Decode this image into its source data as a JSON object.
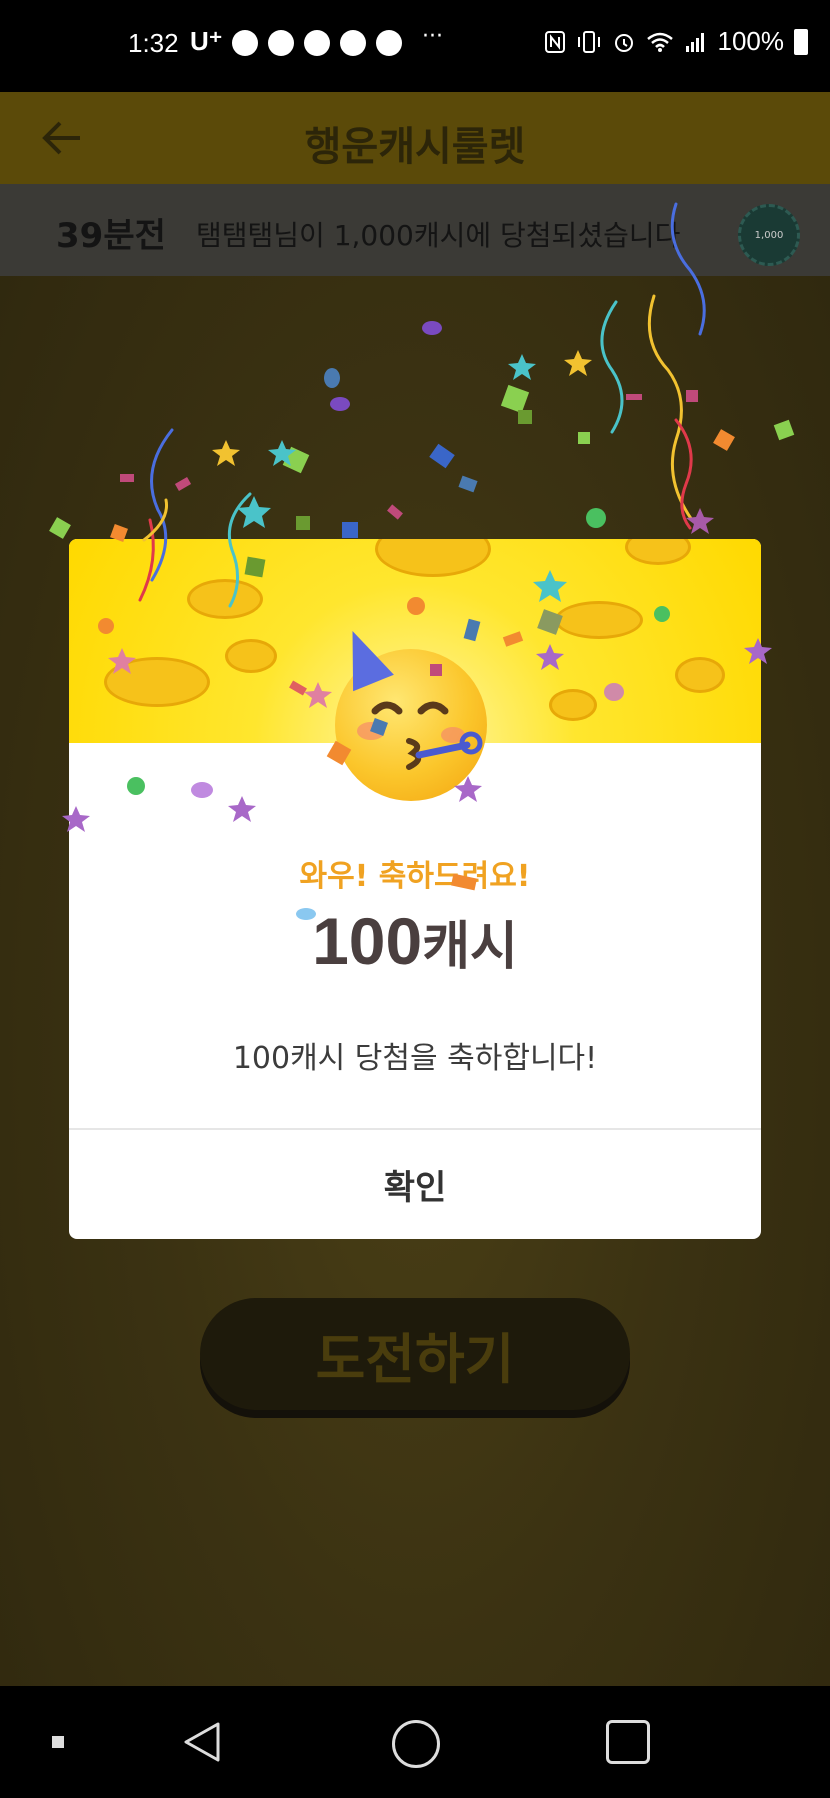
{
  "status_bar": {
    "time": "1:32",
    "carrier": "U⁺",
    "more": "···",
    "battery": "100%",
    "icons": [
      "nfc-icon",
      "vibrate-icon",
      "alarm-icon",
      "wifi-icon",
      "signal-icon",
      "battery-icon"
    ]
  },
  "app": {
    "title": "행운캐시룰렛",
    "ticker": {
      "time": "39분전",
      "message": "탬탬탬님이 1,000캐시에 당첨되셨습니다",
      "badge": "1,000"
    },
    "challenge_button": "도전하기"
  },
  "modal": {
    "congrats": "와우! 축하드려요!",
    "amount_number": "100",
    "amount_unit": "캐시",
    "message": "100캐시 당첨을 축하합니다!",
    "confirm": "확인"
  },
  "colors": {
    "accent_yellow": "#ffe22a",
    "congrats_orange": "#f0a221",
    "amount_text": "#4a3f3f",
    "dim_header": "#5b4a09"
  }
}
